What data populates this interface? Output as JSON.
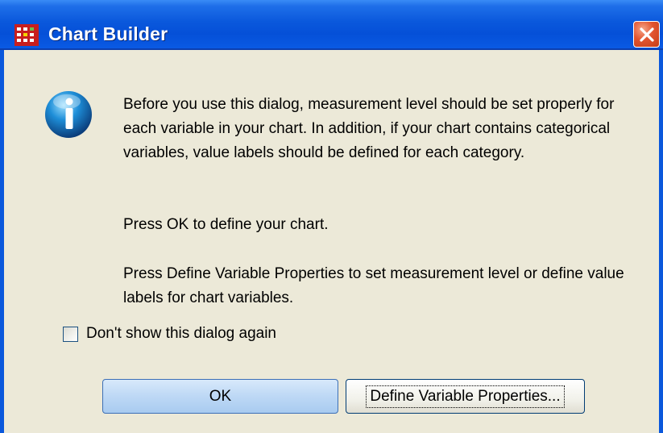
{
  "window": {
    "title": "Chart Builder",
    "app_icon": "chart-builder-grid-icon",
    "close_icon": "close-x-icon",
    "colors": {
      "titlebar": "#0a58dc",
      "body": "#ece9d8",
      "close": "#e2542f"
    }
  },
  "message": {
    "icon": "info-icon",
    "paragraph1": "Before you use this dialog, measurement level should be set properly for each variable in your chart. In addition, if your chart contains categorical variables, value labels should be defined for each category.",
    "paragraph2": "Press OK to define your chart.",
    "paragraph3": "Press Define Variable Properties to set measurement level or define value labels for chart variables."
  },
  "checkbox": {
    "label": "Don't show this dialog again",
    "checked": false
  },
  "buttons": {
    "ok": "OK",
    "define": "Define Variable Properties..."
  }
}
